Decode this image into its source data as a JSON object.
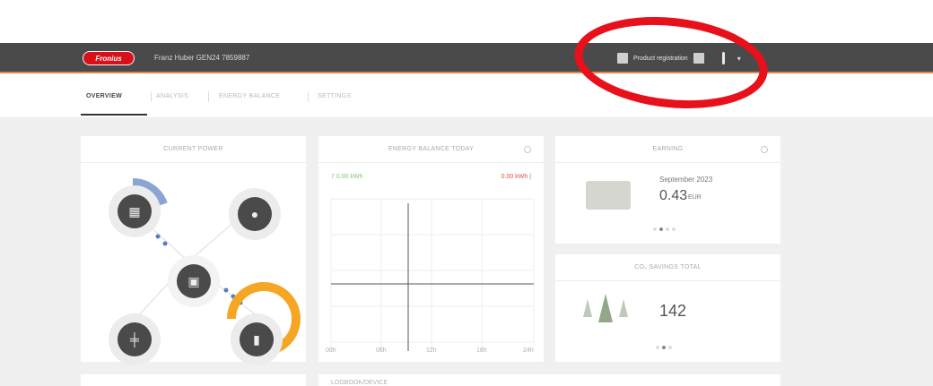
{
  "header": {
    "logo_text": "Fronius",
    "system_name": "Franz Huber GEN24 7859887",
    "product_registration": "Product registration"
  },
  "tabs": [
    {
      "label": "OVERVIEW",
      "active": true
    },
    {
      "label": "ANALYSIS",
      "active": false
    },
    {
      "label": "ENERGY BALANCE",
      "active": false
    },
    {
      "label": "SETTINGS",
      "active": false
    }
  ],
  "current_power": {
    "title": "CURRENT POWER"
  },
  "energy_balance": {
    "title": "ENERGY BALANCE TODAY",
    "produced": "7.0.00 kWh",
    "consumed": "0.00 kWh |",
    "x_ticks": [
      "00h",
      "06h",
      "12h",
      "18h",
      "24h"
    ]
  },
  "earnings": {
    "title": "EARNING",
    "period": "September 2023",
    "value": "0.43",
    "unit": "EUR"
  },
  "co2": {
    "title": "CO₂ SAVINGS TOTAL",
    "value": "142"
  },
  "bottom": {
    "left_title": "",
    "right_title": "LOGBOOK/DEVICE"
  },
  "colors": {
    "header_bg": "#4a4a4a",
    "accent_orange": "#f5a623",
    "accent_blue": "#5b7dbf",
    "produced_green": "#8cc56e",
    "consumed_red": "#e0503c",
    "annotation_red": "#e8101a"
  }
}
